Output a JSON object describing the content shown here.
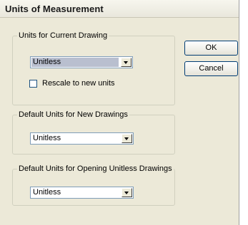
{
  "window": {
    "title": "Units of Measurement"
  },
  "current_drawing": {
    "legend": "Units for Current Drawing",
    "selected_unit": "Unitless",
    "rescale_checkbox_label": "Rescale to new units",
    "rescale_checked": false
  },
  "new_drawings": {
    "legend": "Default Units for New Drawings",
    "selected_unit": "Unitless"
  },
  "opening_unitless": {
    "legend": "Default Units for Opening Unitless Drawings",
    "selected_unit": "Unitless"
  },
  "buttons": {
    "ok_label": "OK",
    "cancel_label": "Cancel"
  },
  "icons": {
    "dropdown": "chevron-down-icon",
    "checkbox": "checkbox-unchecked"
  }
}
